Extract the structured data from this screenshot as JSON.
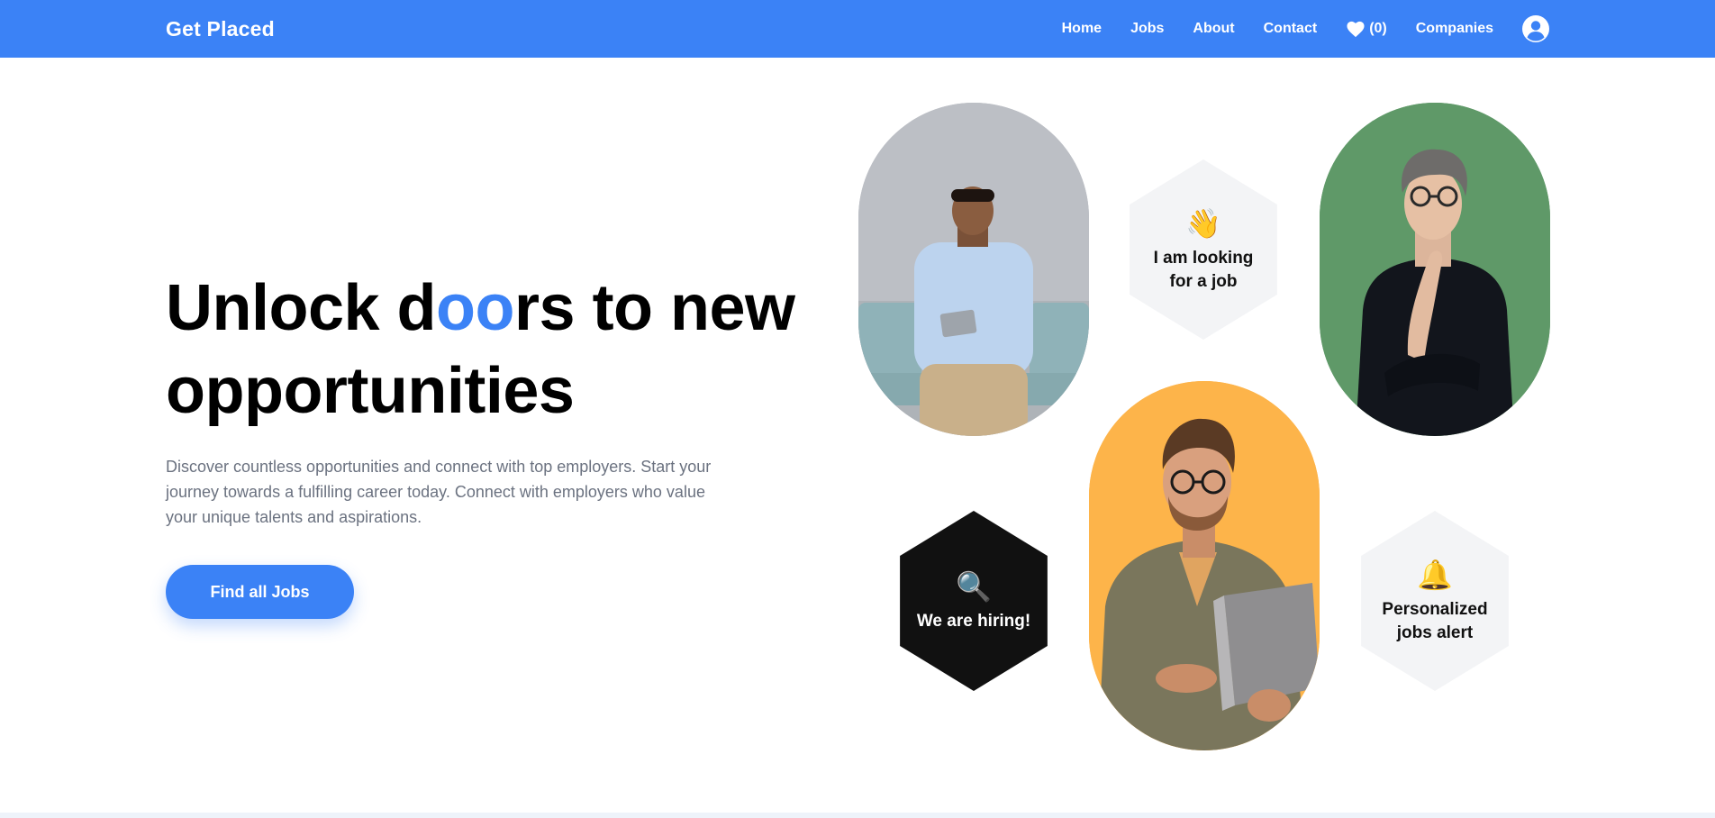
{
  "navbar": {
    "brand": "Get Placed",
    "links": [
      "Home",
      "Jobs",
      "About",
      "Contact"
    ],
    "favorites_count": "(0)",
    "companies": "Companies",
    "icons": [
      "heart-icon",
      "user-avatar-icon"
    ]
  },
  "hero": {
    "title_before": "Unlock d",
    "title_accent": "oo",
    "title_after": "rs to new opportunities",
    "description": "Discover countless opportunities and connect with top employers. Start your journey towards a fulfilling career today. Connect with employers who value your unique talents and aspirations.",
    "cta_label": "Find all Jobs"
  },
  "badges": [
    {
      "emoji": "👋",
      "text": "I am looking for a job",
      "style": "light"
    },
    {
      "emoji": "🔍",
      "text": "We are hiring!",
      "style": "dark"
    },
    {
      "emoji": "🔔",
      "text": "Personalized jobs alert",
      "style": "light"
    }
  ],
  "colors": {
    "primary": "#3b82f6",
    "dark_badge": "#111111",
    "light_badge": "#f3f4f6",
    "photo_1_bg": "#b9bcc3",
    "photo_2_bg": "#5f9968",
    "photo_3_bg": "#fdb44a"
  }
}
